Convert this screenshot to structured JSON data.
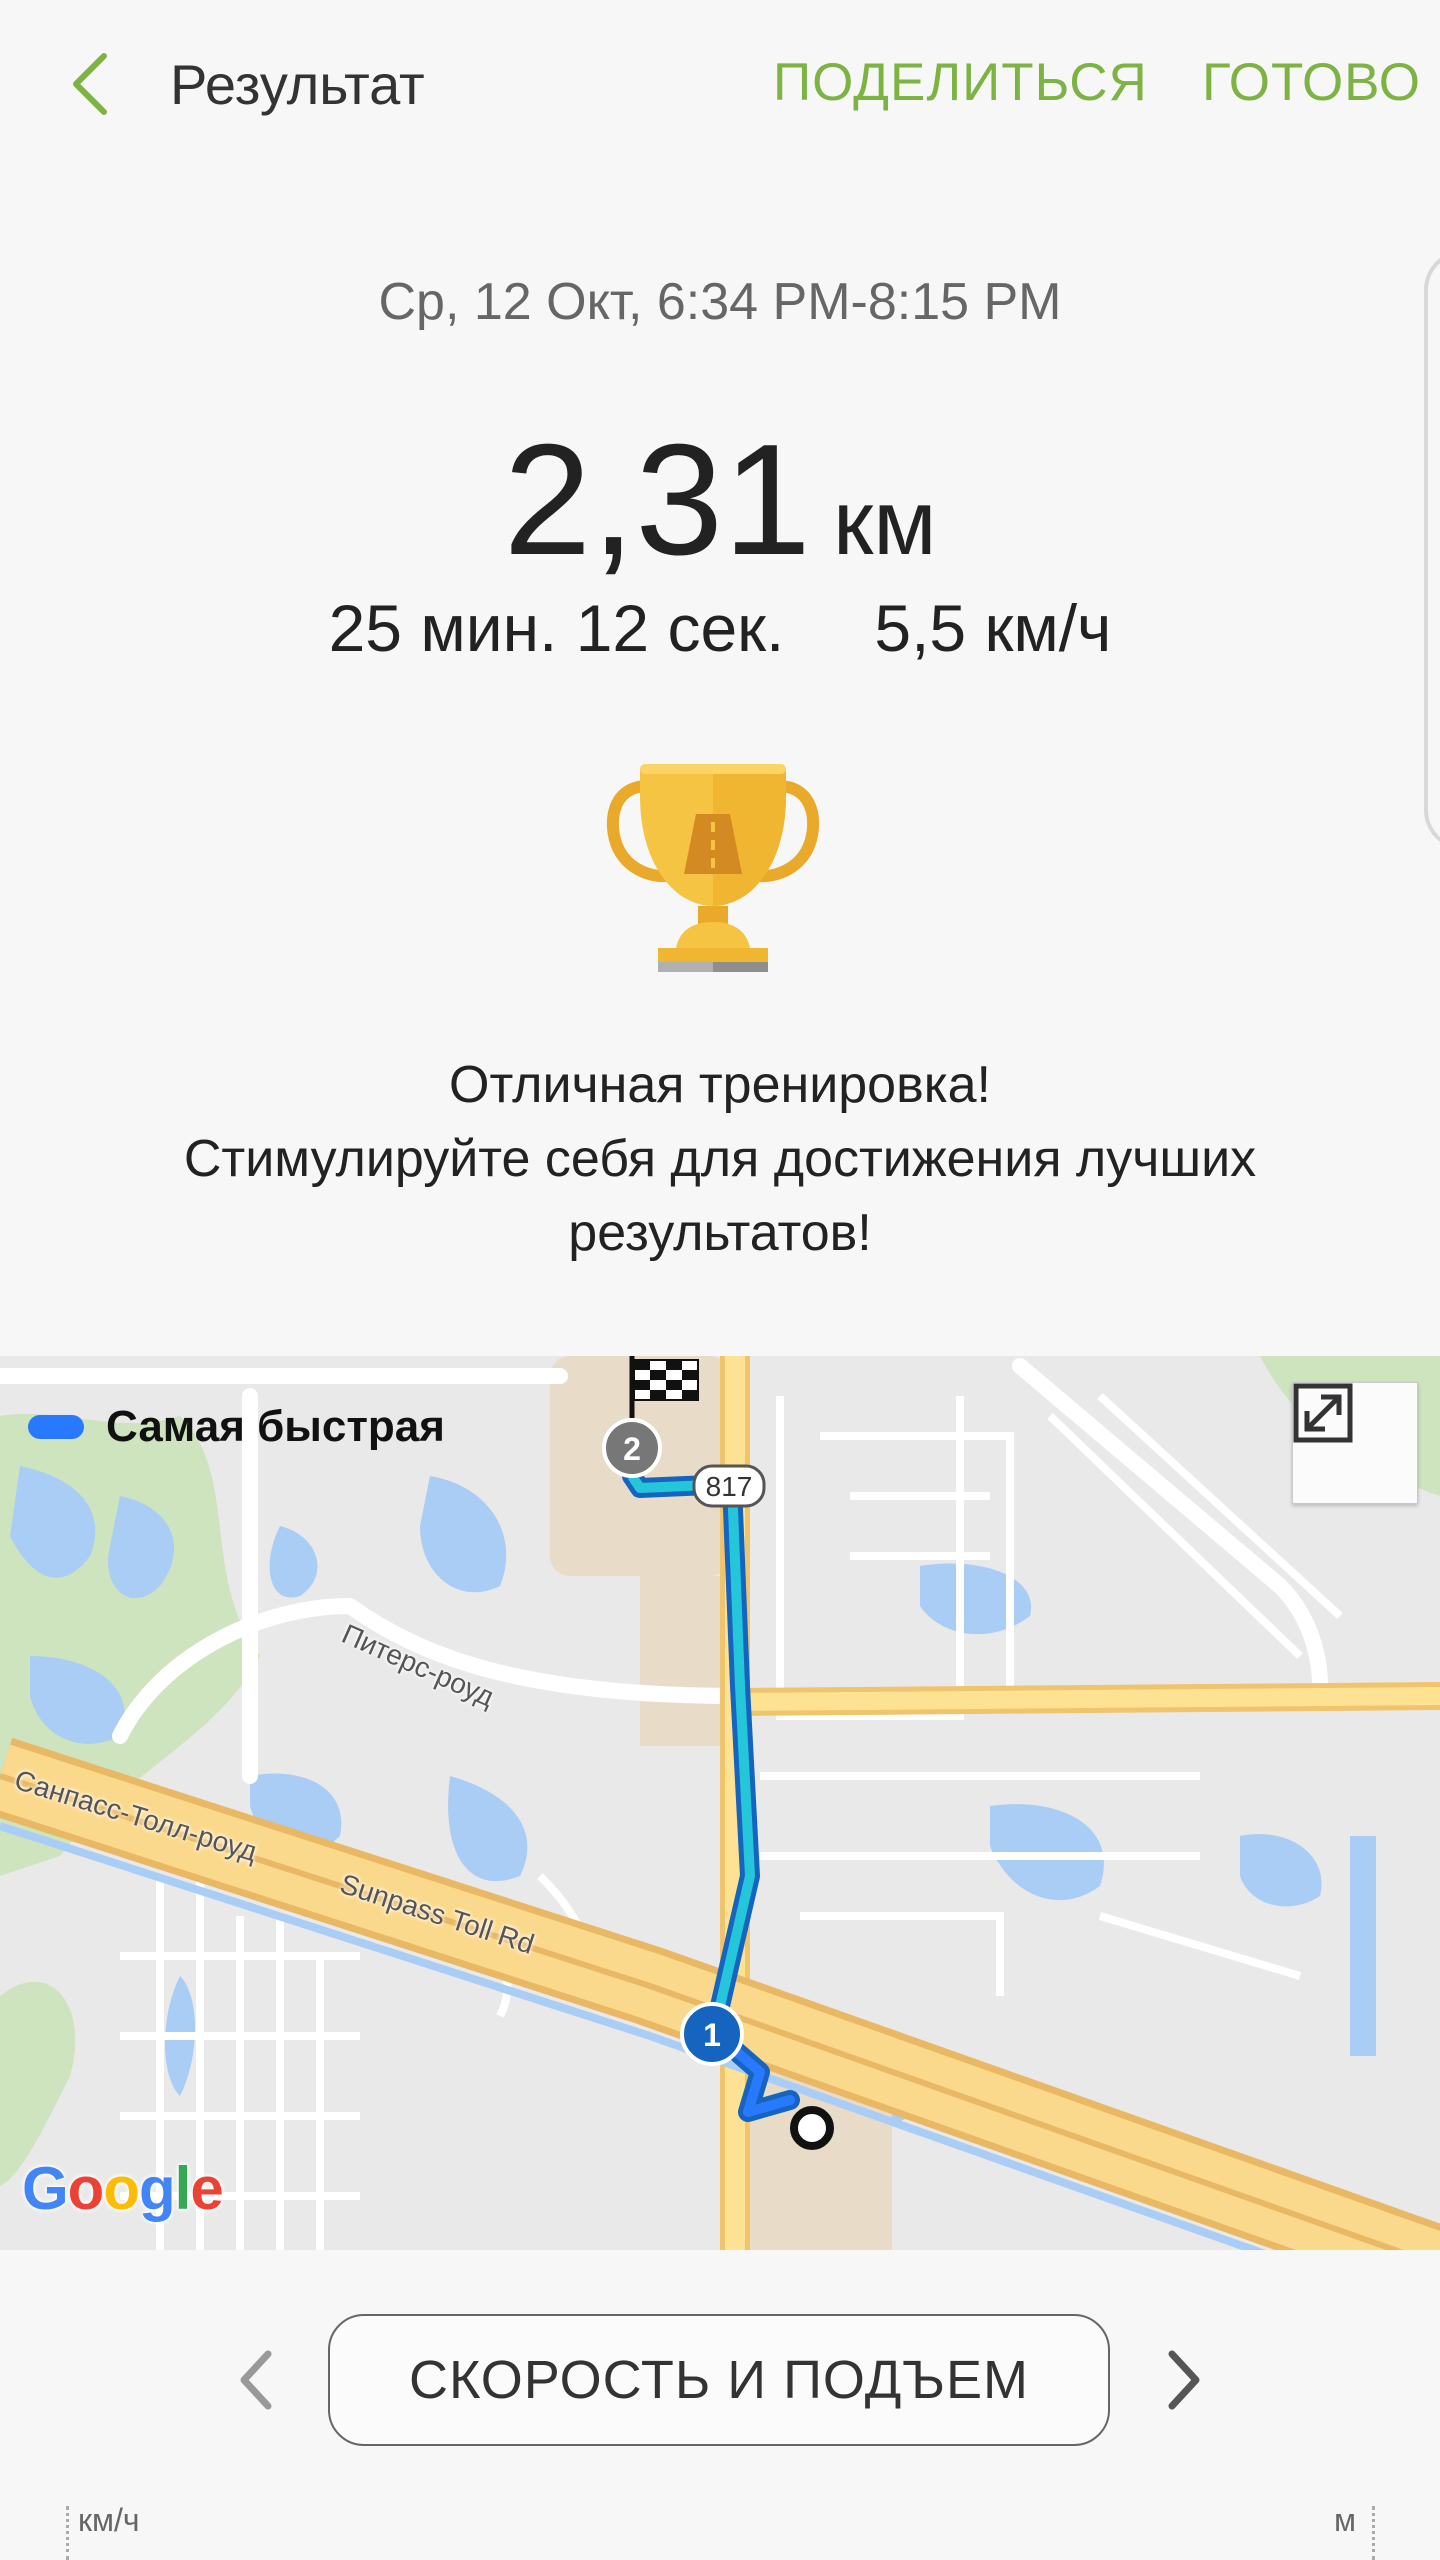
{
  "header": {
    "title": "Результат",
    "share_label": "ПОДЕЛИТЬСЯ",
    "done_label": "ГОТОВО"
  },
  "summary": {
    "date_range": "Ср, 12 Окт, 6:34 PM-8:15 PM",
    "distance_value": "2,31",
    "distance_unit": "км",
    "duration": "25 мин. 12 сек.",
    "avg_speed": "5,5 км/ч"
  },
  "message": {
    "line1": "Отличная тренировка!",
    "line2": "Стимулируйте себя для достижения лучших результатов!"
  },
  "map": {
    "legend_label": "Самая быстрая",
    "route_color": "#2979ff",
    "road_shield": "817",
    "marker_start": "1",
    "marker_finish": "2",
    "labels": {
      "road_peters": "Питерс-роуд",
      "road_sanpass_ru": "Санпасс-Толл-роуд",
      "road_sunpass_en": "Sunpass Toll Rd"
    },
    "logo": "Google"
  },
  "bottom_nav": {
    "tab_label": "СКОРОСТЬ И ПОДЪЕМ"
  },
  "graph": {
    "left_unit": "км/ч",
    "right_unit": "м"
  },
  "colors": {
    "accent": "#7cb342",
    "trophy_gold": "#f6c443"
  }
}
